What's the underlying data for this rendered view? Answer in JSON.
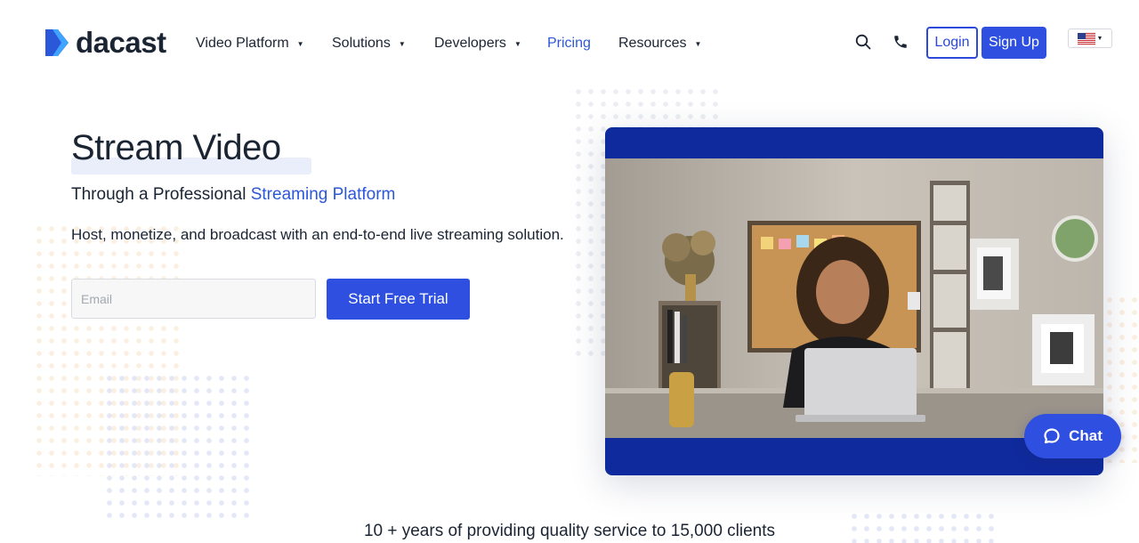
{
  "brand": {
    "name": "dacast",
    "color": "#2b57d9"
  },
  "nav": {
    "items": [
      {
        "label": "Video Platform",
        "has_dropdown": true,
        "active": false
      },
      {
        "label": "Solutions",
        "has_dropdown": true,
        "active": false
      },
      {
        "label": "Developers",
        "has_dropdown": true,
        "active": false
      },
      {
        "label": "Pricing",
        "has_dropdown": false,
        "active": true
      },
      {
        "label": "Resources",
        "has_dropdown": true,
        "active": false
      }
    ],
    "search_icon": "search-icon",
    "phone_icon": "phone-icon",
    "login_label": "Login",
    "signup_label": "Sign Up",
    "language_icon": "us-flag-icon"
  },
  "hero": {
    "title": "Stream Video",
    "subtitle_prefix": "Through a Professional ",
    "subtitle_accent": "Streaming Platform",
    "description": "Host, monetize, and broadcast with an end-to-end live streaming solution.",
    "email_placeholder": "Email",
    "cta_label": "Start Free Trial"
  },
  "chat": {
    "label": "Chat",
    "icon": "chat-bubble-icon"
  },
  "stats": {
    "text": "10 + years of providing quality service to 15,000 clients"
  },
  "colors": {
    "primary": "#2e4fe0",
    "video_frame": "#0f2a9c",
    "text": "#1b2433"
  }
}
